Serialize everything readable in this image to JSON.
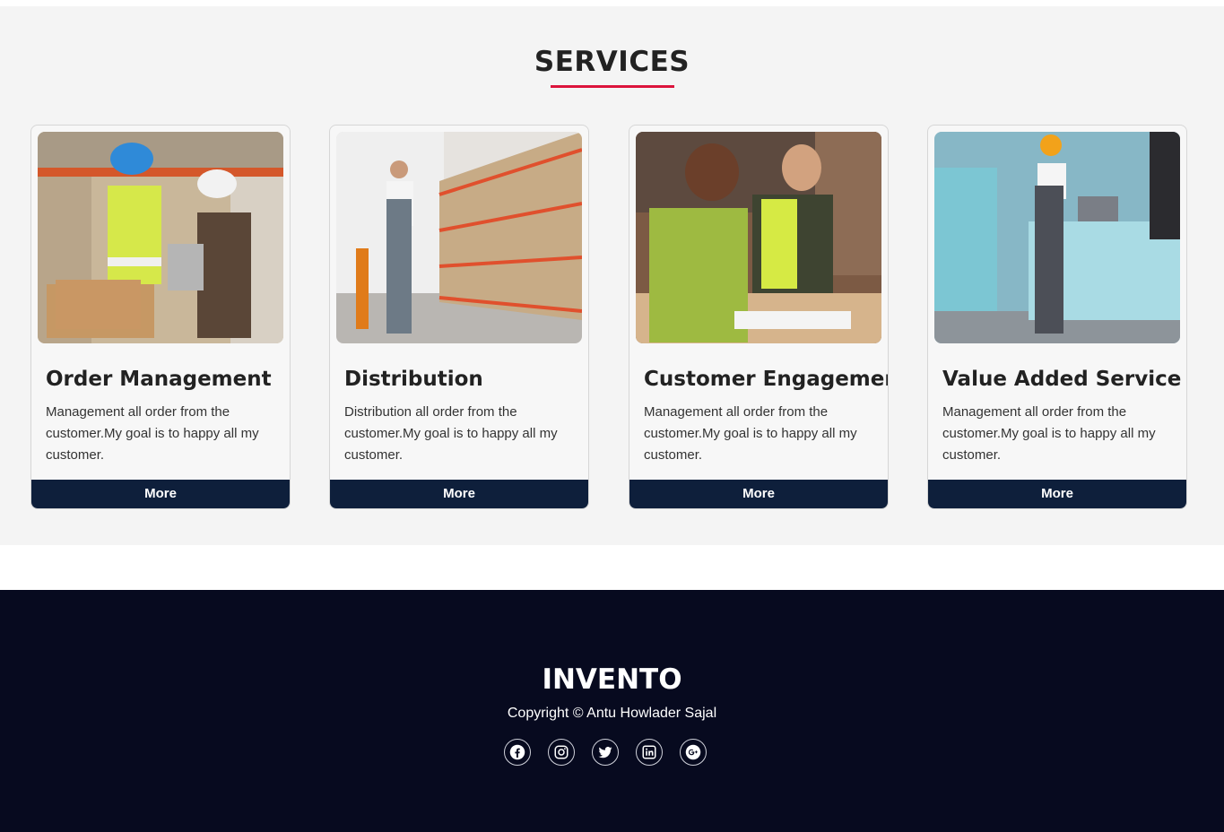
{
  "services": {
    "title": "SERVICES",
    "cards": [
      {
        "title": "Order Management",
        "text": "Management all order from the customer.My goal is to happy all my customer.",
        "button": "More",
        "image": "warehouse-workers-inspecting-box"
      },
      {
        "title": "Distribution",
        "text": "Distribution all order from the customer.My goal is to happy all my customer.",
        "button": "More",
        "image": "worker-walking-warehouse-aisle"
      },
      {
        "title": "Customer Engagement",
        "text": "Management all order from the customer.My goal is to happy all my customer.",
        "button": "More",
        "image": "workers-writing-at-desk"
      },
      {
        "title": "Value Added Service",
        "text": "Management all order from the customer.My goal is to happy all my customer.",
        "button": "More",
        "image": "worker-with-laptop-pallet"
      }
    ]
  },
  "footer": {
    "brand": "INVENTO",
    "copyright": "Copyright © Antu Howlader Sajal",
    "socials": [
      "facebook-icon",
      "instagram-icon",
      "twitter-icon",
      "linkedin-icon",
      "google-plus-icon"
    ]
  },
  "colors": {
    "accent": "#dc143c",
    "button_bg": "#0e1f3b",
    "footer_bg": "#070a1f",
    "section_bg": "#f4f4f4"
  }
}
